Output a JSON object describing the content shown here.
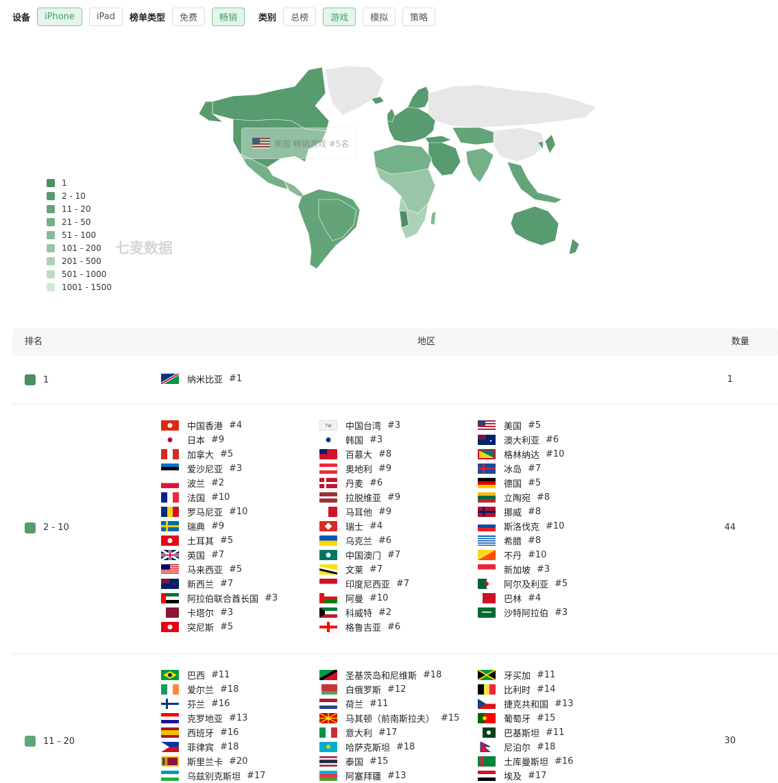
{
  "filters": {
    "device_label": "设备",
    "device_options": [
      "iPhone",
      "iPad"
    ],
    "device_selected": "iPhone",
    "chart_type_label": "榜单类型",
    "chart_type_options": [
      "免费",
      "畅销"
    ],
    "chart_type_selected": "畅销",
    "category_label": "类别",
    "category_options": [
      "总榜",
      "游戏",
      "模拟",
      "策略"
    ],
    "category_selected": "游戏"
  },
  "map": {
    "tooltip": "美国 畅销游戏 #5名",
    "watermark": "七麦数据",
    "legend": [
      {
        "label": "1",
        "color": "#4b8f63"
      },
      {
        "label": "2 - 10",
        "color": "#579b6e"
      },
      {
        "label": "11 - 20",
        "color": "#63a579"
      },
      {
        "label": "21 - 50",
        "color": "#74b088"
      },
      {
        "label": "51 - 100",
        "color": "#86bb97"
      },
      {
        "label": "101 - 200",
        "color": "#98c6a6"
      },
      {
        "label": "201 - 500",
        "color": "#abd1b6"
      },
      {
        "label": "501 - 1000",
        "color": "#bedcc6"
      },
      {
        "label": "1001 - 1500",
        "color": "#d2e8d7"
      }
    ]
  },
  "table": {
    "headers": {
      "rank": "排名",
      "region": "地区",
      "count": "数量"
    },
    "groups": [
      {
        "range": "1",
        "count": "1",
        "color": "#4b8f63",
        "items": [
          {
            "name": "纳米比亚",
            "rank": "#1",
            "flag": "namibia"
          }
        ]
      },
      {
        "range": "2 - 10",
        "count": "44",
        "color": "#579b6e",
        "items": [
          {
            "name": "中国香港",
            "rank": "#4",
            "flag": "hk"
          },
          {
            "name": "中国台湾",
            "rank": "#3",
            "flag": "tw"
          },
          {
            "name": "美国",
            "rank": "#5",
            "flag": "us"
          },
          {
            "name": "日本",
            "rank": "#9",
            "flag": "jp"
          },
          {
            "name": "韩国",
            "rank": "#3",
            "flag": "kr"
          },
          {
            "name": "澳大利亚",
            "rank": "#6",
            "flag": "au"
          },
          {
            "name": "加拿大",
            "rank": "#5",
            "flag": "ca"
          },
          {
            "name": "百慕大",
            "rank": "#8",
            "flag": "bm"
          },
          {
            "name": "格林纳达",
            "rank": "#10",
            "flag": "gd"
          },
          {
            "name": "爱沙尼亚",
            "rank": "#3",
            "flag": "ee"
          },
          {
            "name": "奥地利",
            "rank": "#9",
            "flag": "at"
          },
          {
            "name": "冰岛",
            "rank": "#7",
            "flag": "is"
          },
          {
            "name": "波兰",
            "rank": "#2",
            "flag": "pl"
          },
          {
            "name": "丹麦",
            "rank": "#6",
            "flag": "dk"
          },
          {
            "name": "德国",
            "rank": "#5",
            "flag": "de"
          },
          {
            "name": "法国",
            "rank": "#10",
            "flag": "fr"
          },
          {
            "name": "拉脱维亚",
            "rank": "#9",
            "flag": "lv"
          },
          {
            "name": "立陶宛",
            "rank": "#8",
            "flag": "lt"
          },
          {
            "name": "罗马尼亚",
            "rank": "#10",
            "flag": "ro"
          },
          {
            "name": "马耳他",
            "rank": "#9",
            "flag": "mt"
          },
          {
            "name": "挪威",
            "rank": "#8",
            "flag": "no"
          },
          {
            "name": "瑞典",
            "rank": "#9",
            "flag": "se"
          },
          {
            "name": "瑞士",
            "rank": "#4",
            "flag": "ch"
          },
          {
            "name": "斯洛伐克",
            "rank": "#10",
            "flag": "sk"
          },
          {
            "name": "土耳其",
            "rank": "#5",
            "flag": "tr"
          },
          {
            "name": "乌克兰",
            "rank": "#6",
            "flag": "ua"
          },
          {
            "name": "希腊",
            "rank": "#8",
            "flag": "gr"
          },
          {
            "name": "英国",
            "rank": "#7",
            "flag": "gb"
          },
          {
            "name": "中国澳门",
            "rank": "#7",
            "flag": "mo"
          },
          {
            "name": "不丹",
            "rank": "#10",
            "flag": "bt"
          },
          {
            "name": "马来西亚",
            "rank": "#5",
            "flag": "my"
          },
          {
            "name": "文莱",
            "rank": "#7",
            "flag": "bn"
          },
          {
            "name": "新加坡",
            "rank": "#3",
            "flag": "sg"
          },
          {
            "name": "新西兰",
            "rank": "#7",
            "flag": "nz"
          },
          {
            "name": "印度尼西亚",
            "rank": "#7",
            "flag": "id"
          },
          {
            "name": "阿尔及利亚",
            "rank": "#5",
            "flag": "dz"
          },
          {
            "name": "阿拉伯联合酋长国",
            "rank": "#3",
            "flag": "ae"
          },
          {
            "name": "阿曼",
            "rank": "#10",
            "flag": "om"
          },
          {
            "name": "巴林",
            "rank": "#4",
            "flag": "bh"
          },
          {
            "name": "卡塔尔",
            "rank": "#3",
            "flag": "qa"
          },
          {
            "name": "科威特",
            "rank": "#2",
            "flag": "kw"
          },
          {
            "name": "沙特阿拉伯",
            "rank": "#3",
            "flag": "sa"
          },
          {
            "name": "突尼斯",
            "rank": "#5",
            "flag": "tn"
          },
          {
            "name": "格鲁吉亚",
            "rank": "#6",
            "flag": "ge"
          }
        ]
      },
      {
        "range": "11 - 20",
        "count": "30",
        "color": "#63a579",
        "items": [
          {
            "name": "巴西",
            "rank": "#11",
            "flag": "br"
          },
          {
            "name": "圣基茨岛和尼维斯",
            "rank": "#18",
            "flag": "kn"
          },
          {
            "name": "牙买加",
            "rank": "#11",
            "flag": "jm"
          },
          {
            "name": "爱尔兰",
            "rank": "#18",
            "flag": "ie"
          },
          {
            "name": "白俄罗斯",
            "rank": "#12",
            "flag": "by"
          },
          {
            "name": "比利时",
            "rank": "#14",
            "flag": "be"
          },
          {
            "name": "芬兰",
            "rank": "#16",
            "flag": "fi"
          },
          {
            "name": "荷兰",
            "rank": "#11",
            "flag": "nl"
          },
          {
            "name": "捷克共和国",
            "rank": "#13",
            "flag": "cz"
          },
          {
            "name": "克罗地亚",
            "rank": "#13",
            "flag": "hr"
          },
          {
            "name": "马其顿（前南斯拉夫）",
            "rank": "#15",
            "flag": "mk"
          },
          {
            "name": "葡萄牙",
            "rank": "#15",
            "flag": "pt"
          },
          {
            "name": "西班牙",
            "rank": "#16",
            "flag": "es"
          },
          {
            "name": "意大利",
            "rank": "#17",
            "flag": "it"
          },
          {
            "name": "巴基斯坦",
            "rank": "#11",
            "flag": "pk"
          },
          {
            "name": "菲律宾",
            "rank": "#18",
            "flag": "ph"
          },
          {
            "name": "哈萨克斯坦",
            "rank": "#18",
            "flag": "kz"
          },
          {
            "name": "尼泊尔",
            "rank": "#18",
            "flag": "np"
          },
          {
            "name": "斯里兰卡",
            "rank": "#20",
            "flag": "lk"
          },
          {
            "name": "泰国",
            "rank": "#15",
            "flag": "th"
          },
          {
            "name": "土库曼斯坦",
            "rank": "#16",
            "flag": "tm"
          },
          {
            "name": "乌兹别克斯坦",
            "rank": "#17",
            "flag": "uz"
          },
          {
            "name": "阿塞拜疆",
            "rank": "#13",
            "flag": "az"
          },
          {
            "name": "埃及",
            "rank": "#17",
            "flag": "eg"
          }
        ]
      }
    ]
  }
}
